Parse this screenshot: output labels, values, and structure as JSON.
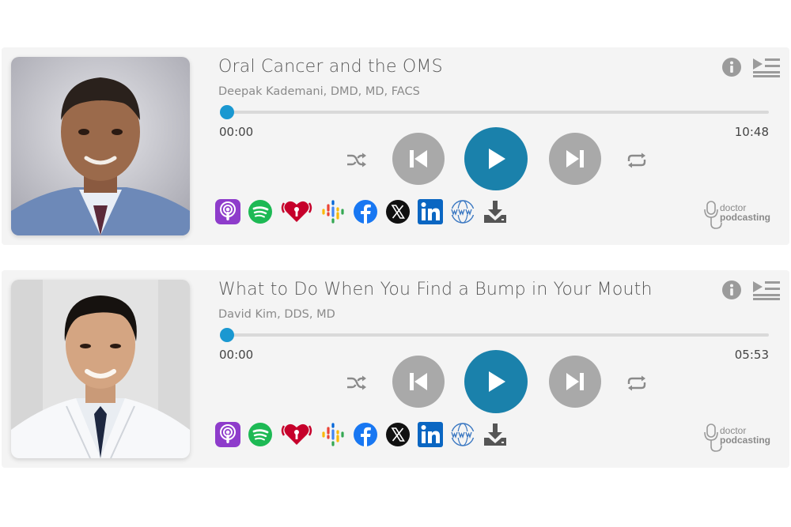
{
  "players": [
    {
      "title": "Oral Cancer and the OMS",
      "author": "Deepak Kademani, DMD, MD, FACS",
      "current_time": "00:00",
      "duration": "10:48",
      "progress": 0.0,
      "photo_icon": "headshot-bald-man-blue-suit"
    },
    {
      "title": "What to Do When You Find a Bump in Your Mouth",
      "author": "David Kim, DDS, MD",
      "current_time": "00:00",
      "duration": "05:53",
      "progress": 0.0,
      "photo_icon": "headshot-man-white-coat"
    }
  ],
  "controls": {
    "shuffle_icon": "shuffle-icon",
    "prev_icon": "skip-previous-icon",
    "play_icon": "play-icon",
    "next_icon": "skip-next-icon",
    "repeat_icon": "repeat-icon",
    "info_icon": "info-icon",
    "playlist_icon": "playlist-icon"
  },
  "social_links": [
    "apple-podcasts-icon",
    "spotify-icon",
    "iheartradio-icon",
    "google-podcasts-icon",
    "facebook-icon",
    "x-icon",
    "linkedin-icon",
    "website-icon",
    "download-icon"
  ],
  "brand": {
    "line1": "doctor",
    "line2": "podcasting"
  },
  "colors": {
    "accent": "#1a81ab",
    "knob": "#1a98d1",
    "button_gray": "#a9a9a9",
    "apple_podcasts": "#8e3ccb",
    "spotify": "#1db954",
    "iheart": "#c6002b",
    "facebook": "#1877f2",
    "linkedin": "#0a66c2",
    "www": "#3b78c2"
  }
}
